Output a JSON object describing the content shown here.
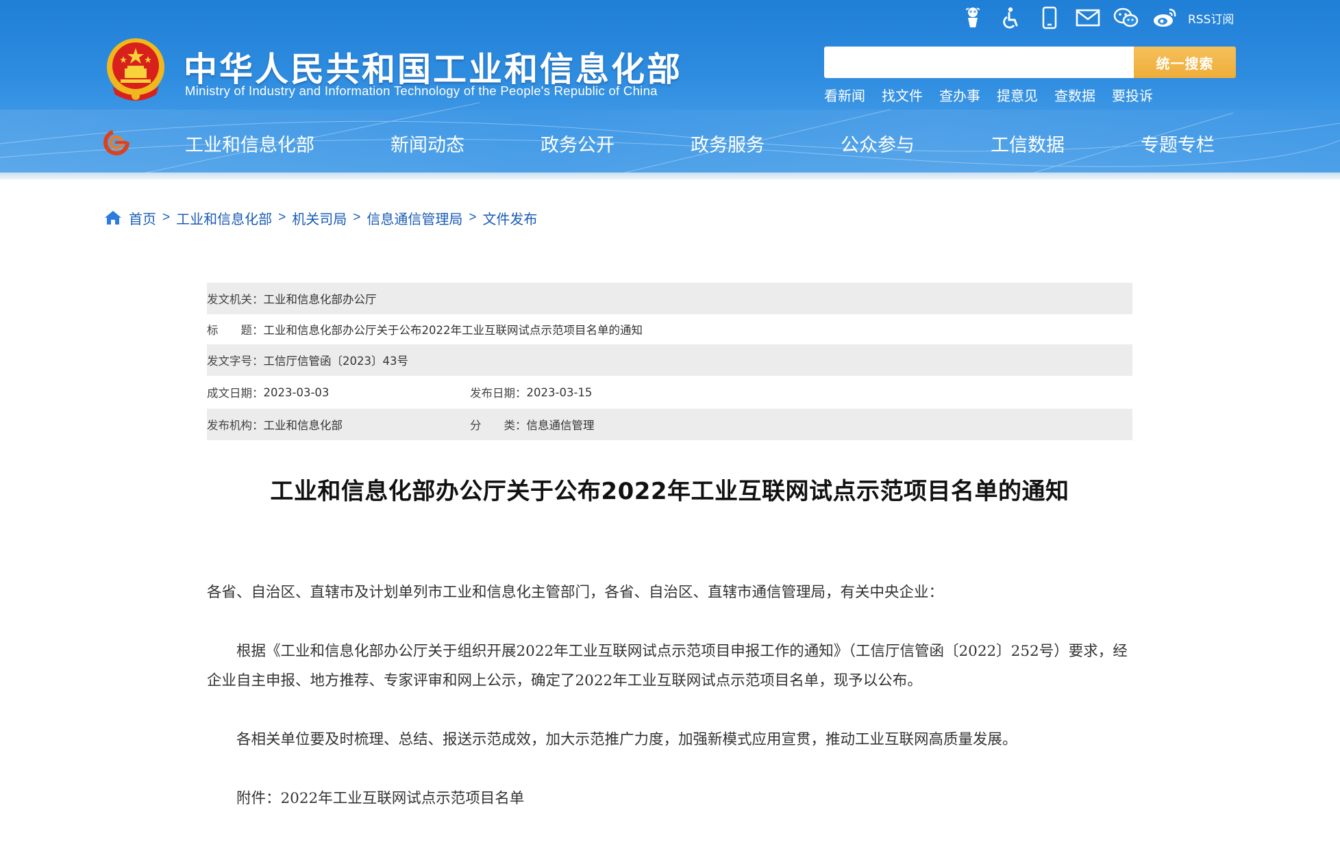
{
  "header": {
    "site_title": "中华人民共和国工业和信息化部",
    "site_subtitle": "Ministry of Industry and Information Technology of the People's Republic of China",
    "top_icons": [
      "robot-icon",
      "accessibility-icon",
      "mobile-icon",
      "mail-icon",
      "wechat-icon",
      "weibo-icon"
    ],
    "rss_label": "RSS订阅",
    "search": {
      "placeholder": "",
      "button_label": "统一搜索"
    },
    "quick_links": [
      "看新闻",
      "找文件",
      "查办事",
      "提意见",
      "查数据",
      "要投诉"
    ],
    "nav": [
      "工业和信息化部",
      "新闻动态",
      "政务公开",
      "政务服务",
      "公众参与",
      "工信数据",
      "专题专栏"
    ]
  },
  "breadcrumb": [
    "首页",
    "工业和信息化部",
    "机关司局",
    "信息通信管理局",
    "文件发布"
  ],
  "meta": {
    "issuer_label": "发文机关：",
    "issuer": "工业和信息化部办公厅",
    "title_label": "标　　题：",
    "title": "工业和信息化部办公厅关于公布2022年工业互联网试点示范项目名单的通知",
    "doc_no_label": "发文字号：",
    "doc_no": "工信厅信管函〔2023〕43号",
    "written_date_label": "成文日期：",
    "written_date": "2023-03-03",
    "publish_date_label": "发布日期：",
    "publish_date": "2023-03-15",
    "publisher_label": "发布机构：",
    "publisher": "工业和信息化部",
    "category_label": "分　　类：",
    "category": "信息通信管理"
  },
  "article": {
    "title": "工业和信息化部办公厅关于公布2022年工业互联网试点示范项目名单的通知",
    "salutation": "各省、自治区、直辖市及计划单列市工业和信息化主管部门，各省、自治区、直辖市通信管理局，有关中央企业：",
    "paragraph_1": "根据《工业和信息化部办公厅关于组织开展2022年工业互联网试点示范项目申报工作的通知》（工信厅信管函〔2022〕252号）要求，经企业自主申报、地方推荐、专家评审和网上公示，确定了2022年工业互联网试点示范项目名单，现予以公布。",
    "paragraph_2": "各相关单位要及时梳理、总结、报送示范成效，加大示范推广力度，加强新模式应用宣贯，推动工业互联网高质量发展。",
    "attachment": "附件：2022年工业互联网试点示范项目名单"
  },
  "colors": {
    "header_blue": "#2f8de0",
    "search_button": "#efad3a",
    "link_blue": "#1a5bb5",
    "meta_shade": "#ececec"
  }
}
